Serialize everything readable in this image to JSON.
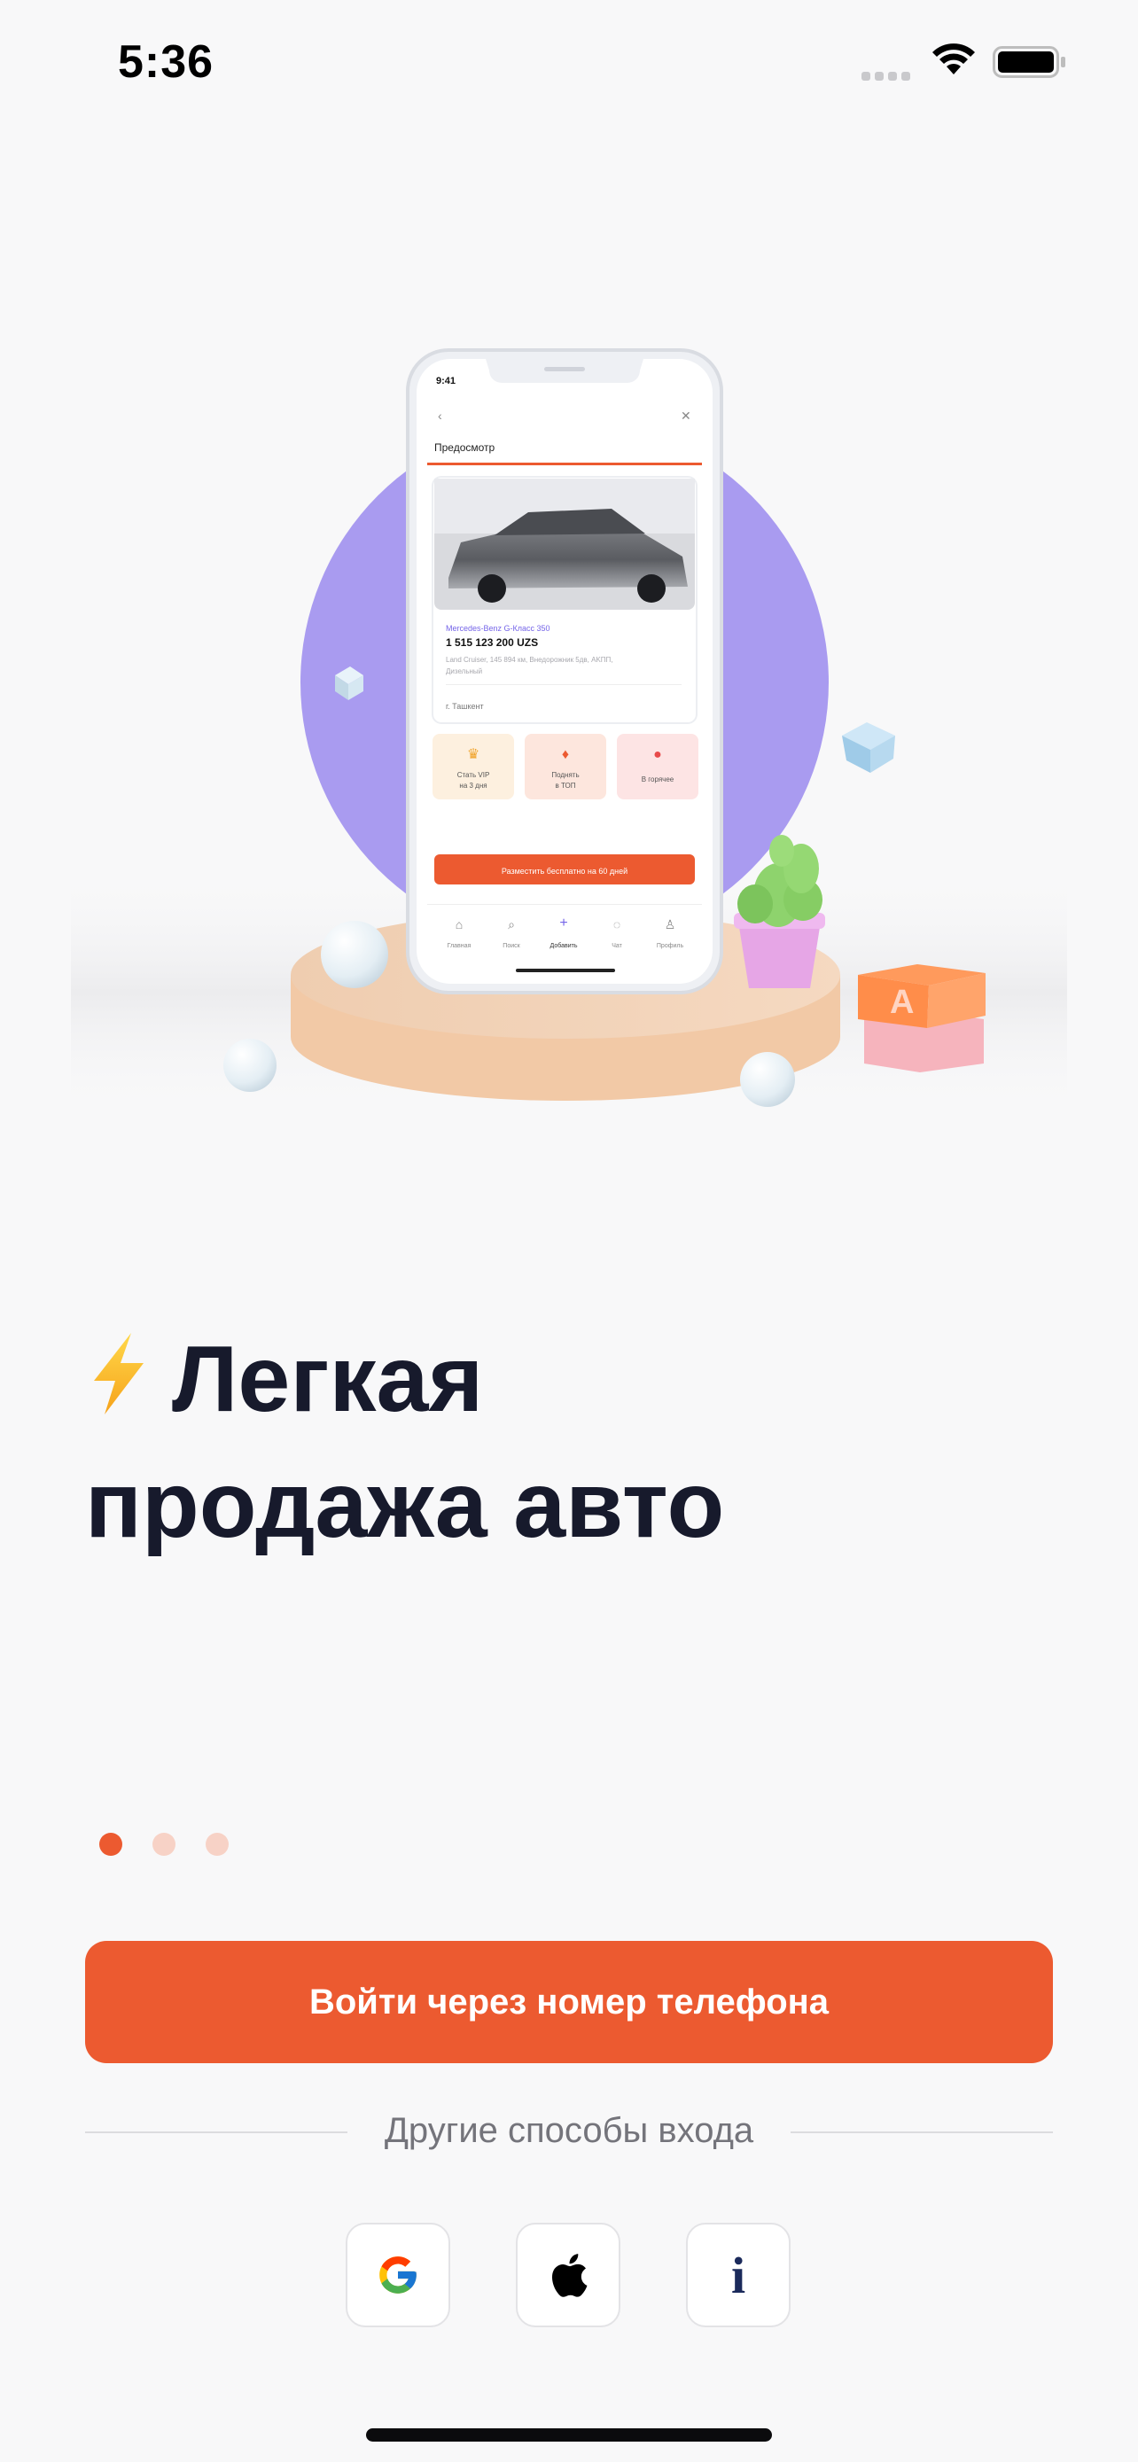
{
  "status_bar": {
    "time": "5:36"
  },
  "hero": {
    "phone_time": "9:41",
    "screen_title": "Предосмотр",
    "car_name": "Mercedes-Benz G-Класс 350",
    "car_price": "1 515 123 200 UZS",
    "car_desc_line1": "Land Cruiser, 145 894 км, Внедорожник 5дв, AKПП,",
    "car_desc_line2": "Дизельный",
    "car_location": "г. Ташкент",
    "promo_1_line1": "Стать VIP",
    "promo_1_line2": "на 3 дня",
    "promo_2_line1": "Поднять",
    "promo_2_line2": "в ТОП",
    "promo_3": "В горячее",
    "publish_button": "Разместить бесплатно на 60 дней",
    "nav_items": [
      "Главная",
      "Поиск",
      "Добавить",
      "Чат",
      "Профиль"
    ],
    "cube_letter": "A"
  },
  "headline": {
    "emoji": "⚡",
    "line1": "Легкая",
    "line2": "продажа авто"
  },
  "pager": {
    "total": 3,
    "active_index": 0
  },
  "login": {
    "primary_button": "Войти через номер телефона",
    "other_methods": "Другие способы входа",
    "methods": [
      "google-icon",
      "apple-icon",
      "info-icon"
    ]
  },
  "colors": {
    "accent": "#EC5A30",
    "accent_light": "#F7D2C6",
    "headline": "#171A2C",
    "purple_circle": "#A99BF0",
    "background": "#F8F8F9"
  }
}
